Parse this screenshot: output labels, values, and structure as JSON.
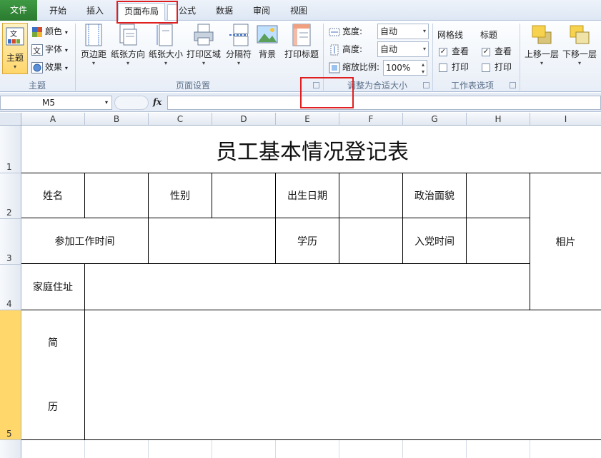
{
  "ribbon_tabs": [
    {
      "label": "文件"
    },
    {
      "label": "开始"
    },
    {
      "label": "插入"
    },
    {
      "label": "页面布局"
    },
    {
      "label": "公式"
    },
    {
      "label": "数据"
    },
    {
      "label": "审阅"
    },
    {
      "label": "视图"
    }
  ],
  "active_tab": "页面布局",
  "ribbon": {
    "theme": {
      "main": "主题",
      "colors": "颜色",
      "fonts": "字体",
      "effects": "效果",
      "group": "主题"
    },
    "page_setup": {
      "margins": "页边距",
      "orientation": "纸张方向",
      "size": "纸张大小",
      "print_area": "打印区域",
      "breaks": "分隔符",
      "background": "背景",
      "print_titles": "打印标题",
      "group": "页面设置"
    },
    "scale": {
      "width_label": "宽度:",
      "width_value": "自动",
      "height_label": "高度:",
      "height_value": "自动",
      "scale_label": "缩放比例:",
      "scale_value": "100%",
      "group": "调整为合适大小"
    },
    "sheet_options": {
      "gridlines": "网格线",
      "headings": "标题",
      "view": "查看",
      "print": "打印",
      "gridlines_view_checked": true,
      "gridlines_print_checked": false,
      "headings_view_checked": true,
      "headings_print_checked": false,
      "group": "工作表选项"
    },
    "arrange": {
      "bring_forward": "上移一层",
      "send_backward": "下移一层"
    }
  },
  "formula_bar": {
    "name_box": "M5",
    "fx": "fx",
    "formula": ""
  },
  "columns": [
    "A",
    "B",
    "C",
    "D",
    "E",
    "F",
    "G",
    "H",
    "I"
  ],
  "rows": [
    "1",
    "2",
    "3",
    "4",
    "5"
  ],
  "selected_row": "5",
  "sheet": {
    "title": "员工基本情况登记表",
    "name_label": "姓名",
    "gender_label": "性别",
    "birth_label": "出生日期",
    "politics_label": "政治面貌",
    "work_time_label": "参加工作时间",
    "education_label": "学历",
    "party_time_label": "入党时间",
    "photo_label": "相片",
    "address_label": "家庭住址",
    "resume_label_1": "简",
    "resume_label_2": "历"
  },
  "colors": {
    "accent_red": "#e02020",
    "file_tab": "#2e7d32",
    "selected_row_header": "#ffd76b"
  }
}
